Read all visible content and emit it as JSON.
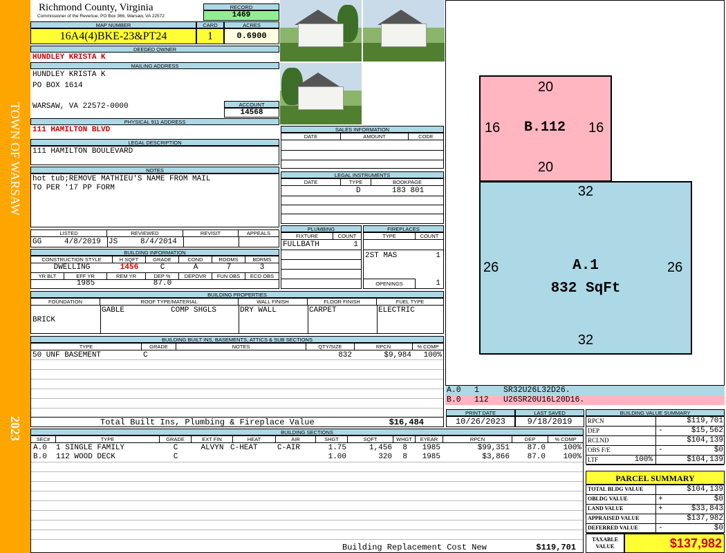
{
  "sidebar": {
    "town": "TOWN OF WARSAW",
    "year": "2023"
  },
  "header": {
    "county": "Richmond County, Virginia",
    "commissioner": "Commissioner of the Revenue, PO Box 366, Warsaw, VA 22572",
    "record_label": "RECORD",
    "record": "1469",
    "map_number_label": "MAP NUMBER",
    "map_number": "16A4(4)BKE-23&PT24",
    "card_label": "CARD",
    "card": "1",
    "acres_label": "ACRES",
    "acres": "0.6900"
  },
  "owner": {
    "deeded_owner_label": "DEEDED OWNER",
    "deeded_owner": "HUNDLEY KRISTA K",
    "mailing_label": "MAILING ADDRESS",
    "mail_line1": "HUNDLEY KRISTA K",
    "mail_line2": "PO BOX 1614",
    "mail_line3": "WARSAW, VA 22572-0000",
    "account_label": "ACCOUNT",
    "account": "14568",
    "physical_label": "PHYSICAL 911 ADDRESS",
    "physical": "111 HAMILTON BLVD",
    "legal_label": "LEGAL DESCRIPTION",
    "legal": "111 HAMILTON BOULEVARD",
    "notes_label": "NOTES",
    "notes_line1": "hot tub;REMOVE MATHIEU'S NAME FROM MAIL",
    "notes_line2": "TO PER '17 PP FORM"
  },
  "listing": {
    "listed_label": "LISTED",
    "listed_by": "GG",
    "listed_date": "4/8/2019",
    "reviewed_label": "REVIEWED",
    "reviewed_by": "JS",
    "reviewed_date": "8/4/2014",
    "revisit_label": "REVISIT",
    "appeals_label": "APPEALS"
  },
  "building_info": {
    "title": "BUILDING INFORMATION",
    "h": [
      "CONSTRUCTION STYLE",
      "H SQFT",
      "GRADE",
      "COND",
      "ROOMS",
      "BDRMS"
    ],
    "style": "DWELLING",
    "hsqft": "1456",
    "grade": "C",
    "cond": "A",
    "rooms": "7",
    "bdrms": "3",
    "h2": [
      "YR BLT",
      "EFF YR",
      "REM YR",
      "DEP %",
      "DEPOVR",
      "FUN OBS",
      "ECO OBS"
    ],
    "eff_yr": "1985",
    "dep": "87.0"
  },
  "sales": {
    "title": "SALES INFORMATION",
    "h": [
      "DATE",
      "AMOUNT",
      "CODE"
    ]
  },
  "legal_inst": {
    "title": "LEGAL INSTRUMENTS",
    "h": [
      "DATE",
      "TYPE",
      "BOOKPAGE"
    ],
    "type": "D",
    "bookpage": "183 801"
  },
  "plumbing": {
    "title": "PLUMBING",
    "h": [
      "FIXTURE",
      "COUNT"
    ],
    "fixture": "FULLBATH",
    "count": "1"
  },
  "fireplaces": {
    "title": "FIREPLACES",
    "h": [
      "TYPE",
      "COUNT"
    ],
    "type": "2ST MAS",
    "count": "1",
    "openings_label": "OPENINGS",
    "openings": "1"
  },
  "props": {
    "title": "BUILDING PROPERTIES",
    "h": [
      "FOUNDATION",
      "ROOF TYPE/MATERIAL",
      "WALL FINISH",
      "FLOOR FINISH",
      "FUEL TYPE"
    ],
    "foundation": "BRICK",
    "roof_type": "GABLE",
    "roof_mat": "COMP SHGLS",
    "wall": "DRY WALL",
    "floor": "CARPET",
    "fuel": "ELECTRIC"
  },
  "builtins": {
    "title": "BUILDING BUILT INS, BASEMENTS, ATTICS & SUB SECTIONS",
    "h": [
      "TYPE",
      "GRADE",
      "NOTES",
      "QTY/SIZE",
      "RPCN",
      "% COMP"
    ],
    "rows": [
      {
        "type": "50 UNF BASEMENT",
        "grade": "C",
        "notes": "",
        "qty": "832",
        "rpcn": "$9,984",
        "comp": "100%"
      }
    ],
    "total_label": "Total Built Ins, Plumbing & Fireplace Value",
    "total": "$16,484"
  },
  "dates": {
    "print_label": "PRINT DATE",
    "print": "10/26/2023",
    "saved_label": "LAST SAVED",
    "saved": "9/18/2019"
  },
  "sections": {
    "title": "BUILDING SECTIONS",
    "h": [
      "SEC#",
      "TYPE",
      "GRADE",
      "EXT FIN",
      "HEAT",
      "AIR",
      "SHGT",
      "SQFT",
      "WHGT",
      "EYEAR",
      "RPCN",
      "DEP",
      "% COMP"
    ],
    "rows": [
      {
        "sec": "A.0",
        "type": "1 SINGLE FAMILY",
        "grade": "C",
        "ext": "ALVYN",
        "heat": "C-HEAT",
        "air": "C-AIR",
        "shgt": "1.75",
        "sqft": "1,456",
        "whgt": "8",
        "eyear": "1985",
        "rpcn": "$99,351",
        "dep": "87.0",
        "comp": "100%"
      },
      {
        "sec": "B.0",
        "type": "112 WOOD DECK",
        "grade": "C",
        "ext": "",
        "heat": "",
        "air": "",
        "shgt": "1.00",
        "sqft": "320",
        "whgt": "8",
        "eyear": "1985",
        "rpcn": "$3,866",
        "dep": "87.0",
        "comp": "100%"
      }
    ],
    "replacement_label": "Building Replacement Cost New",
    "replacement": "$119,701"
  },
  "sketch": {
    "b_label": "B.112",
    "b_top": "20",
    "b_bottom": "20",
    "b_left": "16",
    "b_right": "16",
    "a_label": "A.1",
    "a_sqft": "832 SqFt",
    "a_top": "32",
    "a_bottom": "32",
    "a_left": "26",
    "a_right": "26",
    "legend": [
      {
        "code": "A.0",
        "num": "1",
        "path": "SR32U26L32D26."
      },
      {
        "code": "B.0",
        "num": "112",
        "path": "U26SR20U16L20D16."
      }
    ],
    "colors": {
      "a": "#ADD8E6",
      "b": "#FFB6C1"
    }
  },
  "value_summary": {
    "title": "BUILDING VALUE SUMMARY",
    "rows": [
      {
        "label": "RPCN",
        "sign": "",
        "pct": "",
        "value": "$119,701"
      },
      {
        "label": "DEP",
        "sign": "-",
        "pct": "",
        "value": "$15,562"
      },
      {
        "label": "RCLND",
        "sign": "",
        "pct": "",
        "value": "$104,139"
      },
      {
        "label": "OBS F/E",
        "sign": "-",
        "pct": "",
        "value": "$0"
      },
      {
        "label": "LTF",
        "sign": "",
        "pct": "100%",
        "value": "$104,139"
      }
    ]
  },
  "parcel": {
    "title": "PARCEL SUMMARY",
    "rows": [
      {
        "label": "TOTAL BLDG VALUE",
        "sign": "",
        "value": "$104,139"
      },
      {
        "label": "OBLDG VALUE",
        "sign": "+",
        "value": "$0"
      },
      {
        "label": "LAND VALUE",
        "sign": "+",
        "value": "$33,843"
      },
      {
        "label": "APPRAISED VALUE",
        "sign": "",
        "value": "$137,982"
      },
      {
        "label": "DEFERRED VALUE",
        "sign": "-",
        "value": "$0"
      }
    ],
    "taxable_label1": "TAXABLE",
    "taxable_label2": "VALUE",
    "taxable": "$137,982"
  }
}
